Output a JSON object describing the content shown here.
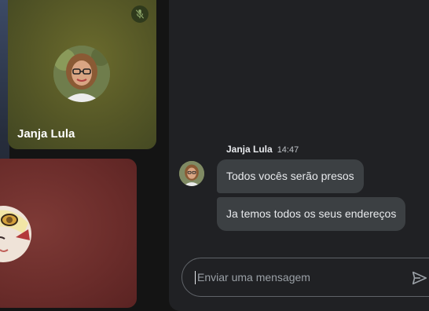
{
  "participants": [
    {
      "name": "Janja Lula",
      "muted": true,
      "tile_color": "#545626"
    },
    {
      "name": "",
      "tile_color": "#6a2c2a"
    }
  ],
  "chat": {
    "messages_group": {
      "sender": "Janja Lula",
      "time": "14:47",
      "messages": [
        "Todos vocês serão presos",
        "Ja temos todos os seus endereços"
      ]
    },
    "composer": {
      "placeholder": "Enviar uma mensagem"
    }
  },
  "icons": {
    "mute": "mic-off-icon",
    "send": "send-icon"
  },
  "colors": {
    "chat_panel_bg": "#202124",
    "bubble_bg": "#3c4043",
    "text": "#e8eaed"
  }
}
